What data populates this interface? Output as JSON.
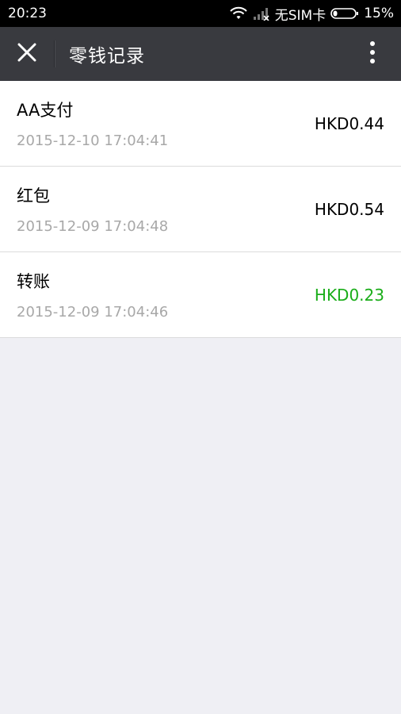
{
  "status_bar": {
    "time": "20:23",
    "sim_text": "无SIM卡",
    "battery_text": "15%"
  },
  "header": {
    "title": "零钱记录"
  },
  "colors": {
    "header_bg": "#393a3f",
    "income_green": "#1aad19",
    "text_black": "#000000",
    "time_gray": "#a8a8a8"
  },
  "records": [
    {
      "title": "AA支付",
      "time": "2015-12-10 17:04:41",
      "amount": "HKD0.44",
      "type": "expense"
    },
    {
      "title": "红包",
      "time": "2015-12-09 17:04:48",
      "amount": "HKD0.54",
      "type": "expense"
    },
    {
      "title": "转账",
      "time": "2015-12-09 17:04:46",
      "amount": "HKD0.23",
      "type": "income"
    }
  ]
}
